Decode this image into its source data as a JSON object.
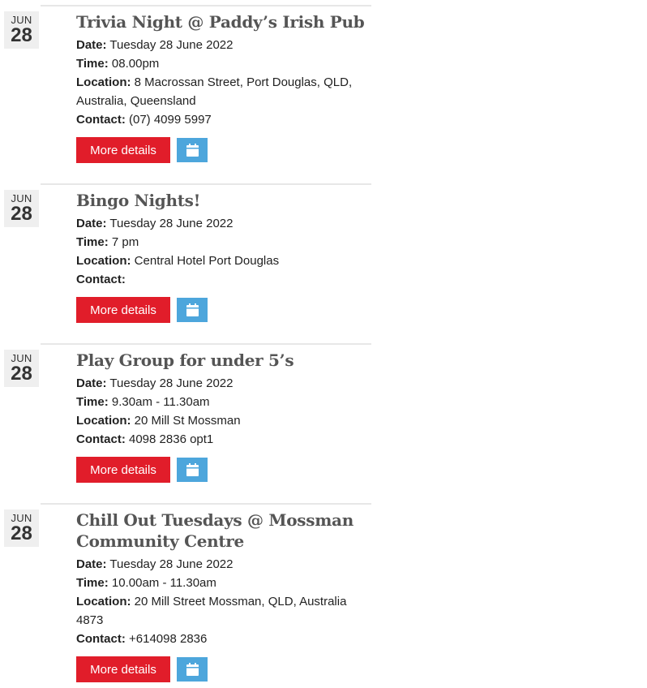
{
  "events": [
    {
      "month": "JUN",
      "day": "28",
      "title": "Trivia Night @ Paddy’s Irish Pub",
      "date_label": "Date:",
      "date_value": "Tuesday 28 June 2022",
      "time_label": "Time:",
      "time_value": "08.00pm",
      "location_label": "Location:",
      "location_value": "8 Macrossan Street, Port Douglas, QLD, Australia, Queensland",
      "contact_label": "Contact:",
      "contact_value": "(07) 4099 5997",
      "more_label": "More details",
      "calendar_icon": "calendar-icon"
    },
    {
      "month": "JUN",
      "day": "28",
      "title": "Bingo Nights!",
      "date_label": "Date:",
      "date_value": "Tuesday 28 June 2022",
      "time_label": "Time:",
      "time_value": "7 pm",
      "location_label": "Location:",
      "location_value": "Central Hotel Port Douglas",
      "contact_label": "Contact:",
      "contact_value": "",
      "more_label": "More details",
      "calendar_icon": "calendar-icon"
    },
    {
      "month": "JUN",
      "day": "28",
      "title": "Play Group for under 5’s",
      "date_label": "Date:",
      "date_value": "Tuesday 28 June 2022",
      "time_label": "Time:",
      "time_value": "9.30am - 11.30am",
      "location_label": "Location:",
      "location_value": "20 Mill St Mossman",
      "contact_label": "Contact:",
      "contact_value": "4098 2836 opt1",
      "more_label": "More details",
      "calendar_icon": "calendar-icon"
    },
    {
      "month": "JUN",
      "day": "28",
      "title": "Chill Out Tuesdays @ Mossman Community Centre",
      "date_label": "Date:",
      "date_value": "Tuesday 28 June 2022",
      "time_label": "Time:",
      "time_value": "10.00am - 11.30am",
      "location_label": "Location:",
      "location_value": "20 Mill Street Mossman, QLD, Australia 4873",
      "contact_label": "Contact:",
      "contact_value": "+614098 2836",
      "more_label": "More details",
      "calendar_icon": "calendar-icon"
    }
  ],
  "colors": {
    "more_button": "#e11d2a",
    "calendar_button": "#4da6dc",
    "date_box": "#efefef",
    "title": "#555555"
  }
}
